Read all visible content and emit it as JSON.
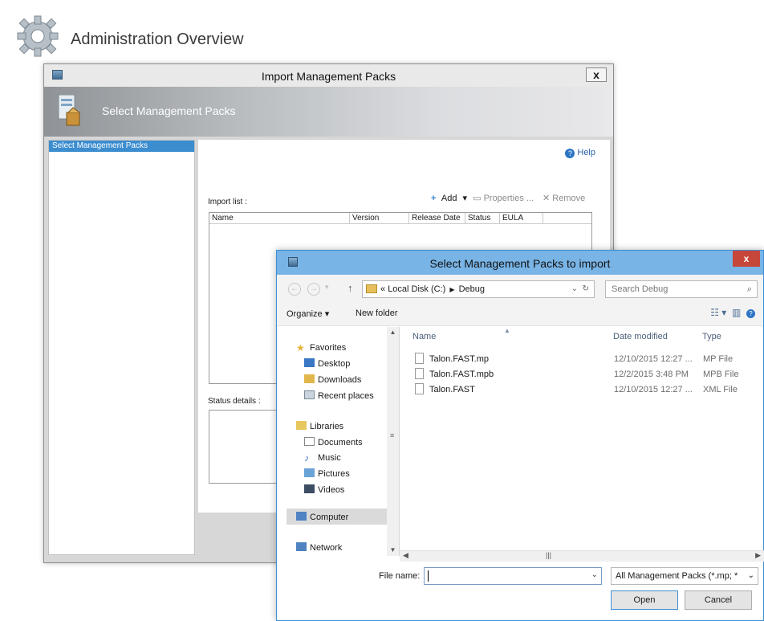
{
  "page": {
    "title": "Administration Overview"
  },
  "import_window": {
    "title": "Import Management Packs",
    "close_label": "x",
    "banner_title": "Select Management Packs",
    "nav_items": [
      "Select Management Packs"
    ],
    "help_label": "Help",
    "toolbar": {
      "add": "Add",
      "properties": "Properties ...",
      "remove": "Remove"
    },
    "import_list_label": "Import list :",
    "columns": [
      "Name",
      "Version",
      "Release Date",
      "Status",
      "EULA"
    ],
    "status_details_label": "Status details :"
  },
  "file_dialog": {
    "title": "Select Management Packs to import",
    "close_label": "x",
    "breadcrumb": [
      "«",
      "Local Disk (C:)",
      "Debug"
    ],
    "search_placeholder": "Search Debug",
    "organize_label": "Organize ▾",
    "new_folder_label": "New folder",
    "tree": {
      "favorites": "Favorites",
      "favorites_items": [
        "Desktop",
        "Downloads",
        "Recent places"
      ],
      "libraries": "Libraries",
      "libraries_items": [
        "Documents",
        "Music",
        "Pictures",
        "Videos"
      ],
      "computer": "Computer",
      "network": "Network"
    },
    "columns": {
      "name": "Name",
      "date": "Date modified",
      "type": "Type"
    },
    "files": [
      {
        "name": "Talon.FAST.mp",
        "date": "12/10/2015 12:27 ...",
        "type": "MP File"
      },
      {
        "name": "Talon.FAST.mpb",
        "date": "12/2/2015 3:48 PM",
        "type": "MPB File"
      },
      {
        "name": "Talon.FAST",
        "date": "12/10/2015 12:27 ...",
        "type": "XML File"
      }
    ],
    "file_name_label": "File name:",
    "file_name_value": "",
    "filter_value": "All Management Packs (*.mp; *",
    "open_label": "Open",
    "cancel_label": "Cancel"
  },
  "colors": {
    "accent": "#3c8dcf",
    "dialog_titlebar": "#79b4e6",
    "close_red": "#c7463a"
  }
}
